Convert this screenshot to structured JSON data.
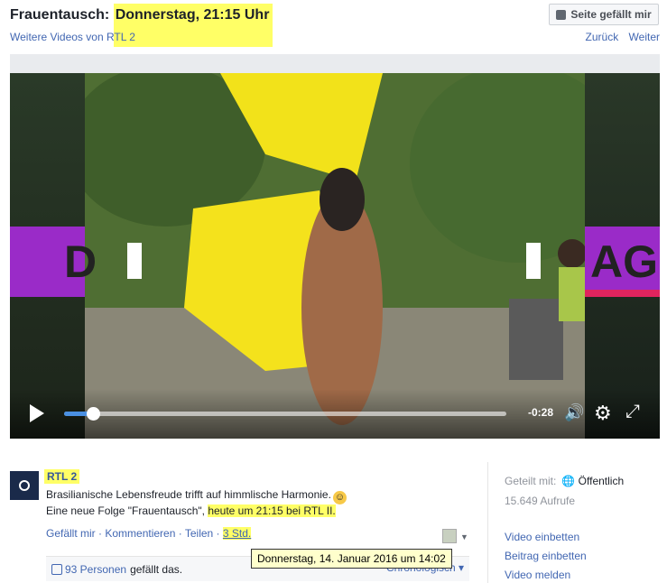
{
  "header": {
    "title_prefix": "Frauentausch:",
    "title_highlight": "Donnerstag, 21:15 Uhr",
    "more_videos": "Weitere Videos von RTL 2",
    "like_page_button": "Seite gefällt mir",
    "nav_back": "Zurück",
    "nav_next": "Weiter"
  },
  "player": {
    "time_remaining": "-0:28",
    "progress_fraction": 0.065,
    "left_banner_text": "D",
    "right_banner_text": "AG"
  },
  "post": {
    "page_name": "RTL 2",
    "line1": "Brasilianische Lebensfreude trifft auf himmlische Harmonie.",
    "line2_prefix": "Eine neue Folge \"Frauentausch\",",
    "line2_highlight": "heute um 21:15 bei RTL II.",
    "action_like": "Gefällt mir",
    "action_comment": "Kommentieren",
    "action_share": "Teilen",
    "timestamp": "3 Std.",
    "tooltip": "Donnerstag, 14. Januar 2016 um 14:02",
    "likes_count": "93 Personen",
    "likes_suffix": "gefällt das.",
    "sort_label": "Chronologisch"
  },
  "sidebar": {
    "shared_label": "Geteilt mit:",
    "shared_value": "Öffentlich",
    "views": "15.649 Aufrufe",
    "links": [
      "Video einbetten",
      "Beitrag einbetten",
      "Video melden"
    ]
  },
  "colors": {
    "highlight": "#ffff66",
    "link": "#4267b2",
    "progress": "#4a90e2"
  }
}
